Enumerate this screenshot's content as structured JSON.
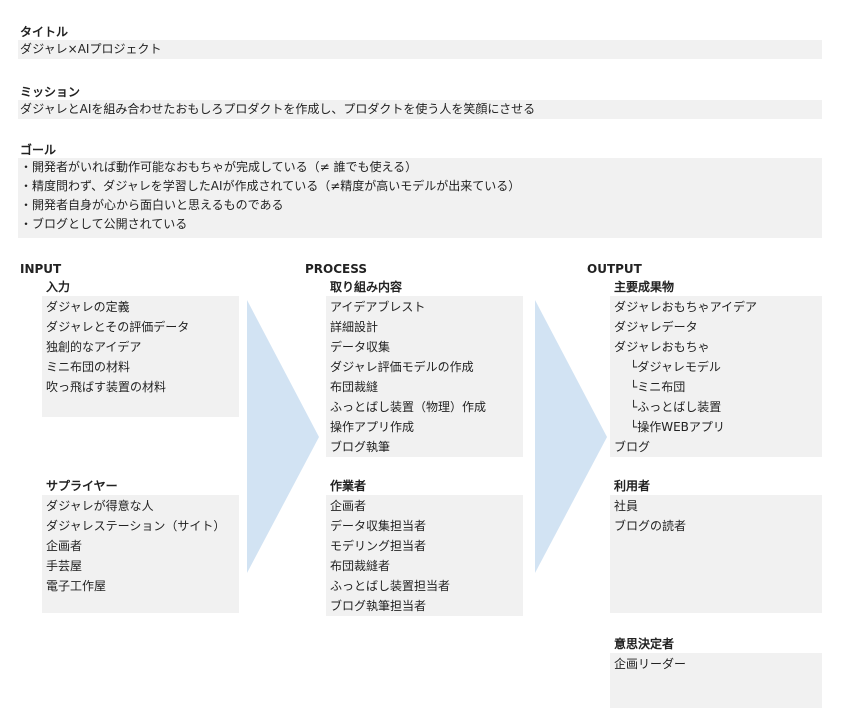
{
  "title_section": {
    "label": "タイトル",
    "value": "ダジャレ×AIプロジェクト"
  },
  "mission_section": {
    "label": "ミッション",
    "value": "ダジャレとAIを組み合わせたおもしろプロダクトを作成し、プロダクトを使う人を笑顔にさせる"
  },
  "goal_section": {
    "label": "ゴール",
    "items": [
      "・開発者がいれば動作可能なおもちゃが完成している（≠ 誰でも使える）",
      "・精度問わず、ダジャレを学習したAIが作成されている（≠精度が高いモデルが出来ている）",
      "・開発者自身が心から面白いと思えるものである",
      "・ブログとして公開されている"
    ]
  },
  "input": {
    "header": "INPUT",
    "nyuryoku": {
      "label": "入力",
      "items": [
        "ダジャレの定義",
        "ダジャレとその評価データ",
        "独創的なアイデア",
        "ミニ布団の材料",
        "吹っ飛ばす装置の材料"
      ]
    },
    "supplier": {
      "label": "サプライヤー",
      "items": [
        "ダジャレが得意な人",
        "ダジャレステーション（サイト）",
        "企画者",
        "手芸屋",
        "電子工作屋"
      ]
    }
  },
  "process": {
    "header": "PROCESS",
    "activities": {
      "label": "取り組み内容",
      "items": [
        "アイデアブレスト",
        "詳細設計",
        "データ収集",
        "ダジャレ評価モデルの作成",
        "布団裁縫",
        "ふっとばし装置（物理）作成",
        "操作アプリ作成",
        "ブログ執筆"
      ]
    },
    "workers": {
      "label": "作業者",
      "items": [
        "企画者",
        "データ収集担当者",
        "モデリング担当者",
        "布団裁縫者",
        "ふっとばし装置担当者",
        "ブログ執筆担当者"
      ]
    }
  },
  "output": {
    "header": "OUTPUT",
    "deliverables": {
      "label": "主要成果物",
      "items": [
        {
          "text": "ダジャレおもちゃアイデア",
          "indent": false
        },
        {
          "text": "ダジャレデータ",
          "indent": false
        },
        {
          "text": "ダジャレおもちゃ",
          "indent": false
        },
        {
          "text": "└ダジャレモデル",
          "indent": true
        },
        {
          "text": "└ミニ布団",
          "indent": true
        },
        {
          "text": "└ふっとばし装置",
          "indent": true
        },
        {
          "text": "└操作WEBアプリ",
          "indent": true
        },
        {
          "text": "ブログ",
          "indent": false
        }
      ]
    },
    "users": {
      "label": "利用者",
      "items": [
        "社員",
        "ブログの読者"
      ]
    },
    "decision_maker": {
      "label": "意思決定者",
      "items": [
        "企画リーダー"
      ]
    }
  },
  "colors": {
    "box_bg": "#f1f1f1",
    "arrow_fill": "#d2e3f3"
  }
}
